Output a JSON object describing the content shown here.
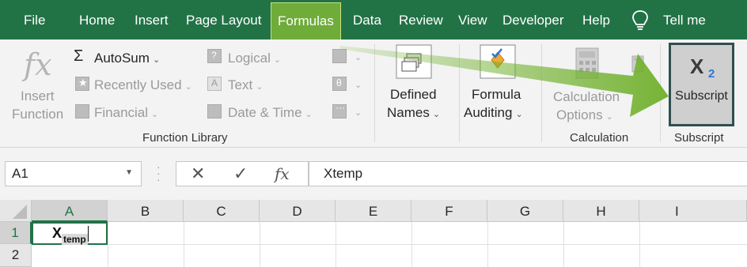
{
  "menu": {
    "tabs": [
      "File",
      "Home",
      "Insert",
      "Page Layout",
      "Formulas",
      "Data",
      "Review",
      "View",
      "Developer",
      "Help"
    ],
    "active_tab": "Formulas",
    "tell_me": "Tell me"
  },
  "ribbon": {
    "function_library": {
      "insert_function": {
        "line1": "Insert",
        "line2": "Function"
      },
      "autosum": "AutoSum",
      "recently_used": "Recently Used",
      "financial": "Financial",
      "logical": "Logical",
      "text": "Text",
      "date_time": "Date & Time",
      "group_label": "Function Library"
    },
    "defined_names": {
      "line1": "Defined",
      "line2": "Names"
    },
    "formula_auditing": {
      "line1": "Formula",
      "line2": "Auditing"
    },
    "calculation": {
      "line1": "Calculation",
      "line2": "Options",
      "group_label": "Calculation"
    },
    "subscript": {
      "button_label": "Subscript",
      "group_label": "Subscript",
      "glyph_main": "X",
      "glyph_sub": "2"
    }
  },
  "formula_bar": {
    "name_box": "A1",
    "cancel_glyph": "✕",
    "enter_glyph": "✓",
    "fx_glyph": "fx",
    "value": "Xtemp"
  },
  "grid": {
    "columns": [
      "A",
      "B",
      "C",
      "D",
      "E",
      "F",
      "G",
      "H",
      "I"
    ],
    "rows": [
      "1",
      "2"
    ],
    "selected_cell": "A1",
    "cell_a1": {
      "main": "X",
      "sub": "temp"
    }
  },
  "colors": {
    "ribbon_green": "#217346",
    "active_tab": "#6fac3a",
    "arrow_green": "#6fb02b",
    "subscript_blue": "#2e75d2"
  }
}
